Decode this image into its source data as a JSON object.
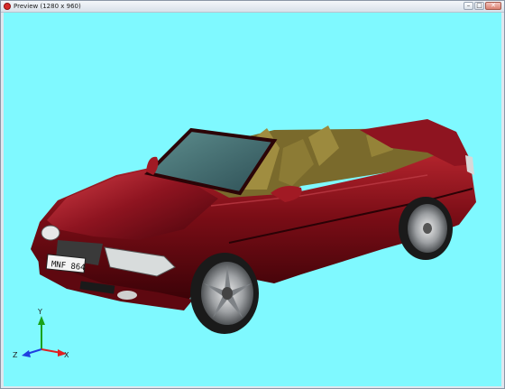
{
  "window": {
    "title": "Preview (1280 x 960)",
    "buttons": {
      "minimize": "–",
      "maximize": "□",
      "close": "✕"
    }
  },
  "viewport": {
    "background_color": "#7ff9ff",
    "plate_text": "MNF 864",
    "axes": {
      "x_label": "X",
      "y_label": "Y",
      "z_label": "Z",
      "x_color": "#e02020",
      "y_color": "#1aa21a",
      "z_color": "#1f3fe0"
    },
    "car_color": "#7a0d16",
    "interior_color": "#7a6a2c"
  }
}
